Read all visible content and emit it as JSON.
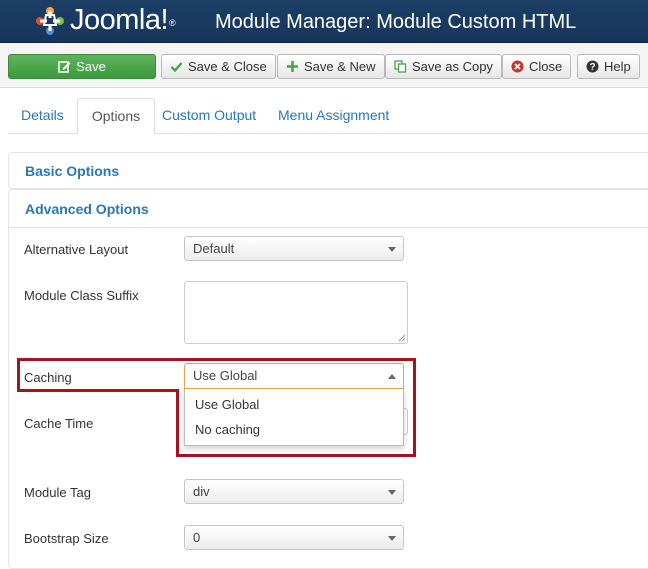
{
  "header": {
    "logo_text": "Joomla!",
    "logo_mark": "®",
    "title": "Module Manager: Module Custom HTML"
  },
  "toolbar": {
    "save": "Save",
    "save_close": "Save & Close",
    "save_new": "Save & New",
    "save_copy": "Save as Copy",
    "close": "Close",
    "help": "Help"
  },
  "tabs": [
    {
      "label": "Details"
    },
    {
      "label": "Options",
      "active": true
    },
    {
      "label": "Custom Output"
    },
    {
      "label": "Menu Assignment"
    }
  ],
  "accordion": {
    "basic": "Basic Options",
    "advanced": "Advanced Options"
  },
  "form": {
    "alternative_layout": {
      "label": "Alternative Layout",
      "value": "Default"
    },
    "module_class_suffix": {
      "label": "Module Class Suffix",
      "value": ""
    },
    "caching": {
      "label": "Caching",
      "value": "Use Global",
      "options": [
        "Use Global",
        "No caching"
      ]
    },
    "cache_time": {
      "label": "Cache Time"
    },
    "module_tag": {
      "label": "Module Tag",
      "value": "div"
    },
    "bootstrap_size": {
      "label": "Bootstrap Size",
      "value": "0"
    }
  },
  "icons": {
    "save": "edit-icon",
    "save_close": "check-icon",
    "save_new": "plus-icon",
    "save_copy": "copy-icon",
    "close": "cancel-icon",
    "help": "question-icon"
  },
  "colors": {
    "header_bg": "#1c3f66",
    "success": "#46a546",
    "link": "#2a77b6",
    "highlight": "#a4141c",
    "focus": "#e6a44a"
  }
}
